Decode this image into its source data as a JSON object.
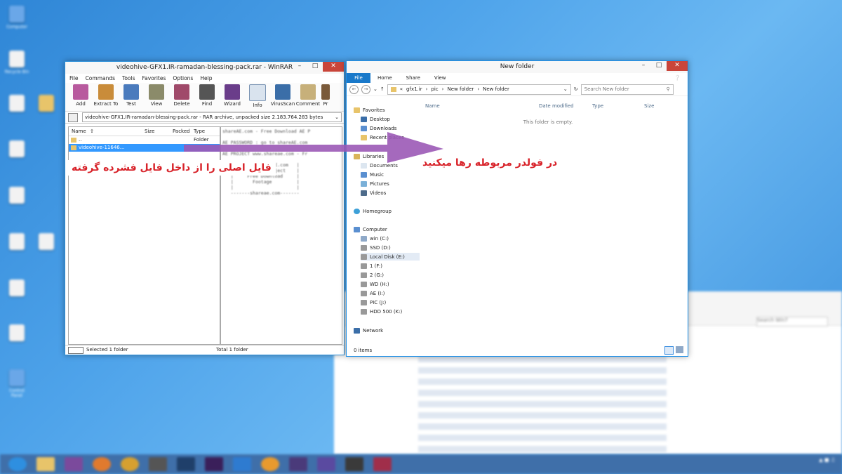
{
  "desktop": {
    "icons": [
      "Computer",
      "Recycle Bin",
      "",
      "",
      "",
      "",
      "",
      "",
      "",
      "",
      "",
      "",
      "",
      "Control Panel"
    ]
  },
  "winrar": {
    "title": "videohive-GFX1.IR-ramadan-blessing-pack.rar - WinRAR",
    "menu": [
      "File",
      "Commands",
      "Tools",
      "Favorites",
      "Options",
      "Help"
    ],
    "tools": [
      "Add",
      "Extract To",
      "Test",
      "View",
      "Delete",
      "Find",
      "Wizard",
      "Info",
      "VirusScan",
      "Comment",
      "Pr"
    ],
    "path": "videohive-GFX1.IR-ramadan-blessing-pack.rar - RAR archive, unpacked size 2.183.764.283 bytes",
    "columns": [
      "Name",
      "Size",
      "Packed",
      "Type"
    ],
    "rows": [
      {
        "name": "..",
        "type": "Folder"
      },
      {
        "name": "videohive-11646...",
        "type": ""
      }
    ],
    "info_text": "shareAE.com - Free Download AE P\n\nAE PASSWORD : go to shareAE.com\n\nAE PROJECT www.shareae.com - Fr\n\n   |  http://shareAE.com   |\n   |    Free AE Project    |\n   |     Free Download     |\n   |       Footage         |\n   |                       |\n   -------shareae.com-------",
    "status_left": "Selected 1 folder",
    "status_right": "Total 1 folder"
  },
  "explorer": {
    "title": "New folder",
    "ribbon": [
      "File",
      "Home",
      "Share",
      "View"
    ],
    "address": [
      "gfx1.ir",
      "pic",
      "New folder",
      "New folder"
    ],
    "search_placeholder": "Search New folder",
    "columns": [
      "Name",
      "Date modified",
      "Type",
      "Size"
    ],
    "empty_text": "This folder is empty.",
    "nav": {
      "favorites": "Favorites",
      "fav_items": [
        "Desktop",
        "Downloads",
        "Recent places"
      ],
      "libraries": "Libraries",
      "lib_items": [
        "Documents",
        "Music",
        "Pictures",
        "Videos"
      ],
      "homegroup": "Homegroup",
      "computer": "Computer",
      "drives": [
        "win (C:)",
        "SSD (D:)",
        "Local Disk (E:)",
        "1 (F:)",
        "2 (G:)",
        "WD (H:)",
        "AE (I:)",
        "PIC (J:)",
        "HDD 500 (K:)"
      ],
      "network": "Network"
    },
    "status": "0 items"
  },
  "annotations": {
    "left": "فایل اصلی را از داخل فایل فشرده گرفته",
    "right": "در فولدر مربوطه رها میکنید"
  },
  "background_explorer": {
    "search_placeholder": "Search Win7"
  },
  "colors": {
    "accent": "#1979ca",
    "arrow": "#9b59b6",
    "close": "#c9453a",
    "annotation": "#d8232a"
  }
}
